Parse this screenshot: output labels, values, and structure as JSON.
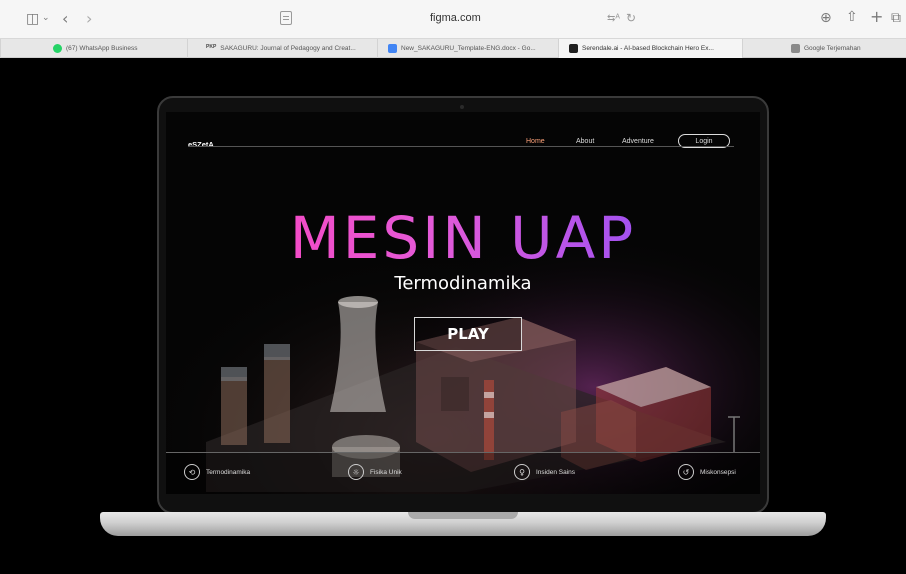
{
  "browser": {
    "address": "figma.com",
    "icons": [
      "sidebar-icon",
      "chevron-down-icon",
      "back-icon",
      "forward-icon",
      "document-icon",
      "translate-icon",
      "reload-icon",
      "download-icon",
      "share-icon",
      "new-tab-icon",
      "tabs-overview-icon"
    ]
  },
  "tabs": [
    {
      "label": "(67) WhatsApp Business",
      "icon": "whatsapp-icon"
    },
    {
      "label": "SAKAGURU: Journal of Pedagogy and Creat...",
      "icon": "pkp-icon",
      "badge": "PKP"
    },
    {
      "label": "New_SAKAGURU_Template-ENG.docx - Go...",
      "icon": "google-docs-icon"
    },
    {
      "label": "Serendale.ai - AI-based Blockchain Hero Ex...",
      "icon": "serendale-icon",
      "active": true
    },
    {
      "label": "Google Terjemahan",
      "icon": "google-translate-icon"
    }
  ],
  "site": {
    "logo": "eSZetA",
    "nav": {
      "home": "Home",
      "about": "About",
      "adventure": "Adventure",
      "login": "Login"
    },
    "hero_title": "MESIN UAP",
    "hero_subtitle": "Termodinamika",
    "play": "PLAY",
    "bottom_nav": [
      {
        "label": "Termodinamika",
        "icon": "flow-icon"
      },
      {
        "label": "Fisika Unik",
        "icon": "sun-icon"
      },
      {
        "label": "Insiden Sains",
        "icon": "lightbulb-icon"
      },
      {
        "label": "Miskonsepsi",
        "icon": "refresh-icon"
      }
    ]
  },
  "colors": {
    "accent_nav": "#ffa37a",
    "title_gradient_start": "#ff3fb8",
    "title_gradient_end": "#7b4dff"
  }
}
